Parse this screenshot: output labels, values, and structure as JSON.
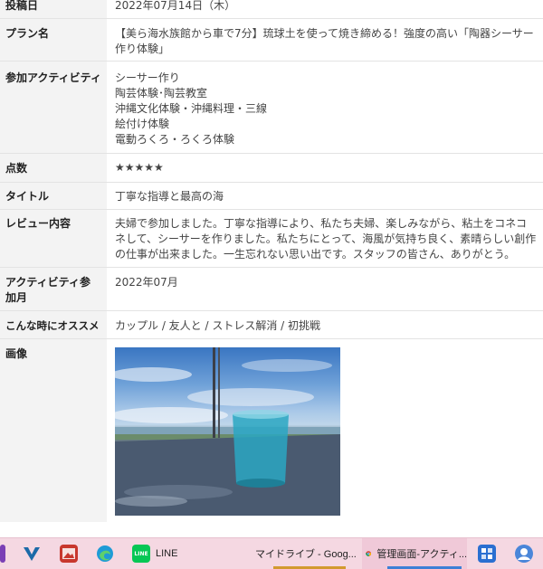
{
  "review": {
    "rows": [
      {
        "key": "posted",
        "label": "投稿日",
        "value": "2022年07月14日（木）"
      },
      {
        "key": "plan",
        "label": "プラン名",
        "value": "【美ら海水族館から車で7分】琉球土を使って焼き締める！強度の高い「陶器シーサー作り体験」"
      },
      {
        "key": "activities",
        "label": "参加アクティビティ",
        "lines": [
          "シーサー作り",
          "陶芸体験･陶芸教室",
          "沖縄文化体験・沖縄料理・三線",
          "絵付け体験",
          "電動ろくろ・ろくろ体験"
        ]
      },
      {
        "key": "score",
        "label": "点数",
        "stars": "★★★★★",
        "rating": 5
      },
      {
        "key": "title",
        "label": "タイトル",
        "value": "丁寧な指導と最高の海"
      },
      {
        "key": "body",
        "label": "レビュー内容",
        "value": "夫婦で参加しました。丁寧な指導により、私たち夫婦、楽しみながら、粘土をコネコネして、シーサーを作りました。私たちにとって、海風が気持ち良く、素晴らしい創作の仕事が出来ました。一生忘れない思い出です。スタッフの皆さん、ありがとう。"
      },
      {
        "key": "month",
        "label": "アクティビティ参加月",
        "value": "2022年07月"
      },
      {
        "key": "recommend",
        "label": "こんな時にオススメ",
        "value": "カップル / 友人と / ストレス解消 / 初挑戦"
      },
      {
        "key": "image",
        "label": "画像"
      }
    ]
  },
  "taskbar": {
    "items": [
      {
        "key": "line",
        "label": "LINE"
      },
      {
        "key": "drive",
        "label": "マイドライブ - Goog..."
      },
      {
        "key": "admin",
        "label": "管理画面-アクティ..."
      }
    ]
  },
  "colors": {
    "label_bg": "#f3f3f3",
    "star": "#f5a623",
    "taskbar_bg": "#f5d8e2",
    "active_indicator": "#3d7fd6"
  }
}
